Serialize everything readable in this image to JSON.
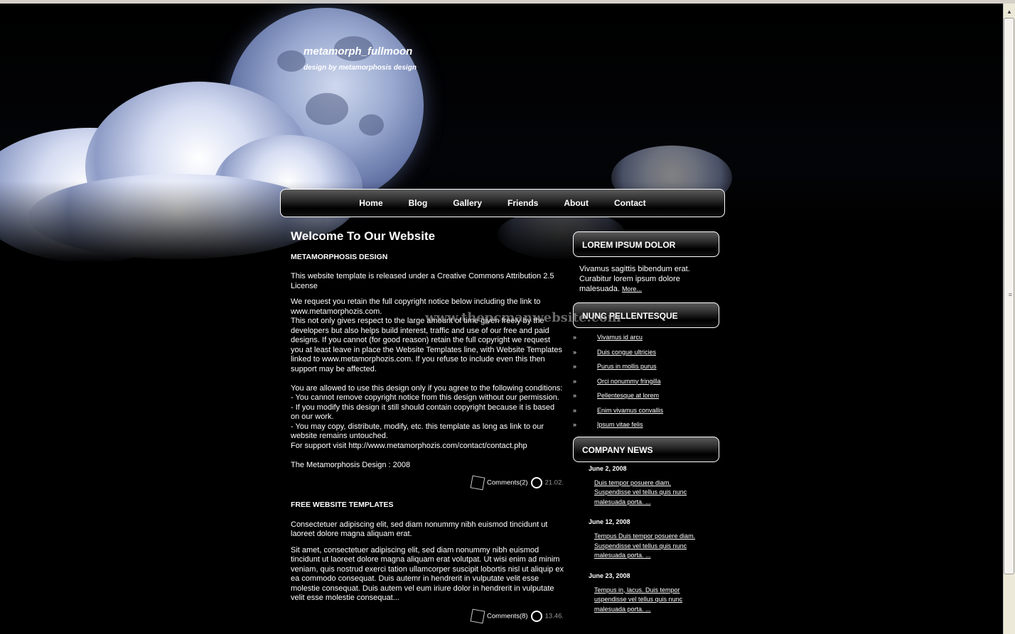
{
  "header": {
    "title": "metamorph_fullmoon",
    "subtitle": "design by metamorphosis design"
  },
  "nav": [
    "Home",
    "Blog",
    "Gallery",
    "Friends",
    "About",
    "Contact"
  ],
  "watermark": "www.thepcmanwebsite.com",
  "main": {
    "heading": "Welcome To Our Website",
    "posts": [
      {
        "title": "METAMORPHOSIS DESIGN",
        "paragraphs": [
          "This website template is released under a Creative Commons Attribution 2.5 License",
          "We request you retain the full copyright notice below including the link to www.metamorphozis.com.\nThis not only gives respect to the large amount of time given freely by the developers but also helps build interest, traffic and use of our free and paid designs. If you cannot (for good reason) retain the full copyright we request you at least leave in place the Website Templates line, with Website Templates linked to www.metamorphozis.com. If you refuse to include even this then support may be affected.\n\nYou are allowed to use this design only if you agree to the following conditions:\n- You cannot remove copyright notice from this design without our permission.\n- If you modify this design it still should contain copyright because it is based on our work.\n- You may copy, distribute, modify, etc. this template as long as link to our website remains untouched.\nFor support visit http://www.metamorphozis.com/contact/contact.php\n\nThe Metamorphosis Design : 2008"
        ],
        "comments": "Comments(2)",
        "date": "21.02."
      },
      {
        "title": "FREE WEBSITE TEMPLATES",
        "paragraphs": [
          "Consectetuer adipiscing elit, sed diam nonummy nibh euismod tincidunt ut laoreet dolore magna aliquam erat.",
          "Sit amet, consectetuer adipiscing elit, sed diam nonummy nibh euismod tincidunt ut laoreet dolore magna aliquam erat volutpat. Ut wisi enim ad minim veniam, quis nostrud exerci tation ullamcorper suscipit lobortis nisl ut aliquip ex ea commodo consequat. Duis autemr in hendrerit in vulputate velit esse molestie consequat. Duis autem vel eum iriure dolor in hendrerit in vulputate velit esse molestie consequat..."
        ],
        "comments": "Comments(8)",
        "date": "13.46."
      }
    ]
  },
  "sidebar": {
    "box1": {
      "title": "LOREM IPSUM DOLOR",
      "text": "Vivamus sagittis bibendum erat. Curabitur lorem ipsum dolore malesuada.",
      "more": "More..."
    },
    "box2": {
      "title": "NUNC PELLENTESQUE",
      "links": [
        "Vivamus id arcu",
        "Duis congue ultricies",
        "Purus in mollis purus",
        "Orci nonummy fringilla",
        "Pellentesque at lorem",
        "Enim vivamus convallis",
        "Ipsum vitae felis"
      ]
    },
    "box3": {
      "title": "COMPANY NEWS",
      "items": [
        {
          "date": "June 2, 2008",
          "text": "Duis tempor posuere diam. Suspendisse vel tellus quis nunc malesuada porta. ..."
        },
        {
          "date": "June 12, 2008",
          "text": "Tempus Duis tempor posuere diam. Suspendisse vel tellus quis nunc malesuada porta. ..."
        },
        {
          "date": "June 23, 2008",
          "text": "Tempus in, lacus. Duis tempor uspendisse vel tellus quis nunc malesuada porta. ..."
        }
      ]
    }
  }
}
